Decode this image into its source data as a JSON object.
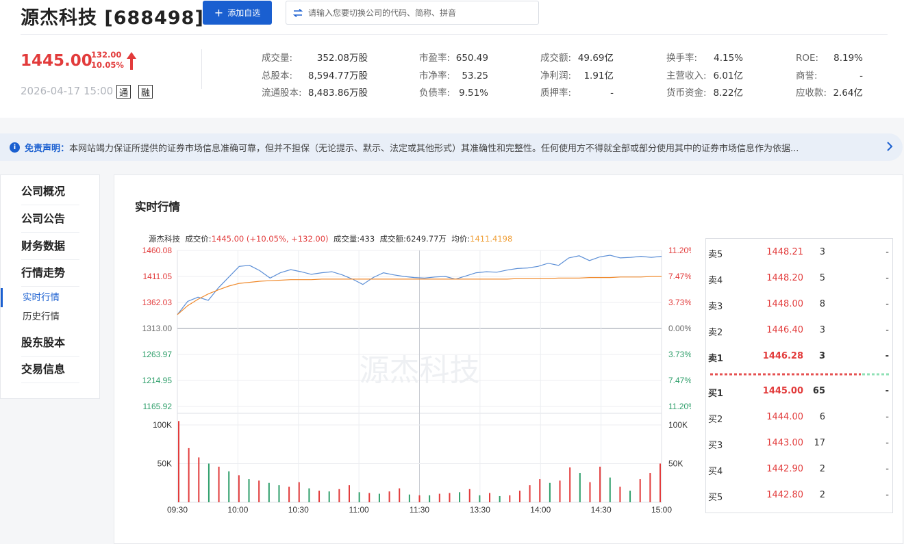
{
  "header": {
    "title": "源杰科技 [688498]",
    "add_button": "添加自选",
    "search_placeholder": "请输入您要切换公司的代码、简称、拼音",
    "price": "1445.00",
    "change": "132.00",
    "change_pct": "10.05%",
    "datetime": "2026-04-17 15:00",
    "tag_tong": "通",
    "tag_rong": "融",
    "stats": [
      {
        "label": "成交量:",
        "value": "352.08万股"
      },
      {
        "label": "总股本:",
        "value": "8,594.77万股"
      },
      {
        "label": "流通股本:",
        "value": "8,483.86万股"
      },
      {
        "label": "市盈率:",
        "value": "650.49"
      },
      {
        "label": "市净率:",
        "value": "53.25"
      },
      {
        "label": "负债率:",
        "value": "9.51%"
      },
      {
        "label": "成交额:",
        "value": "49.69亿"
      },
      {
        "label": "净利润:",
        "value": "1.91亿"
      },
      {
        "label": "质押率:",
        "value": "-"
      },
      {
        "label": "换手率:",
        "value": "4.15%"
      },
      {
        "label": "主营收入:",
        "value": "6.01亿"
      },
      {
        "label": "货币资金:",
        "value": "8.22亿"
      },
      {
        "label": "ROE:",
        "value": "8.19%"
      },
      {
        "label": "商誉:",
        "value": "-"
      },
      {
        "label": "应收款:",
        "value": "2.64亿"
      }
    ]
  },
  "notice": {
    "label": "免责声明：",
    "text": "本网站竭力保证所提供的证券市场信息准确可靠，但并不担保（无论提示、默示、法定或其他形式）其准确性和完整性。任何使用方不得就全部或部分使用其中的证券市场信息作为依据..."
  },
  "sidebar": {
    "items": [
      "公司概况",
      "公司公告",
      "财务数据",
      "行情走势",
      "股东股本",
      "交易信息"
    ],
    "sub_items": [
      "实时行情",
      "历史行情"
    ]
  },
  "main": {
    "title": "实时行情",
    "info": {
      "name": "源杰科技",
      "price_label": "成交价:",
      "price_value": "1445.00 (+10.05%, +132.00)",
      "volume_label": "成交量:",
      "volume_value": "433",
      "amount_label": "成交额:",
      "amount_value": "6249.77万",
      "avg_label": "均价:",
      "avg_value": "1411.4198"
    },
    "watermark": "源杰科技"
  },
  "chart_data": {
    "type": "line",
    "x_ticks": [
      "09:30",
      "10:00",
      "10:30",
      "11:00",
      "11:30",
      "13:30",
      "14:00",
      "14:30",
      "15:00"
    ],
    "y_price_ticks": [
      "1460.08",
      "1411.05",
      "1362.03",
      "1313.00",
      "1263.97",
      "1214.95",
      "1165.92"
    ],
    "y_pct_ticks": [
      "11.20%",
      "7.47%",
      "3.73%",
      "0.00%",
      "3.73%",
      "7.47%",
      "11.20%"
    ],
    "y_vol_ticks": [
      "100K",
      "50K"
    ],
    "ylim": [
      1165.92,
      1460.08
    ],
    "prev_close": 1313.0,
    "series": [
      {
        "values": [
          1339,
          1364,
          1372,
          1366,
          1390,
          1410,
          1430,
          1432,
          1422,
          1408,
          1418,
          1424,
          1420,
          1415,
          1418,
          1420,
          1414,
          1406,
          1396,
          1409,
          1418,
          1414,
          1411,
          1409,
          1408,
          1410,
          1411,
          1406,
          1412,
          1418,
          1420,
          1419,
          1423,
          1426,
          1427,
          1430,
          1436,
          1432,
          1446,
          1450,
          1441,
          1448,
          1451,
          1446,
          1447,
          1449,
          1447,
          1449
        ]
      },
      {
        "values": [
          1339,
          1356,
          1368,
          1378,
          1386,
          1393,
          1398,
          1400,
          1402,
          1403,
          1404,
          1405,
          1405,
          1405,
          1406,
          1406,
          1406,
          1406,
          1406,
          1406,
          1406,
          1406,
          1406,
          1406,
          1406,
          1406,
          1406,
          1406,
          1406,
          1406,
          1406,
          1406,
          1406,
          1407,
          1407,
          1407,
          1407,
          1408,
          1408,
          1408,
          1409,
          1409,
          1409,
          1410,
          1410,
          1410,
          1411,
          1411
        ]
      }
    ],
    "volume": [
      105,
      70,
      58,
      50,
      46,
      40,
      35,
      30,
      28,
      25,
      22,
      20,
      26,
      18,
      15,
      14,
      17,
      22,
      13,
      12,
      11,
      14,
      18,
      10,
      9,
      9,
      11,
      12,
      13,
      17,
      9,
      12,
      8,
      9,
      15,
      22,
      30,
      25,
      28,
      45,
      38,
      26,
      46,
      32,
      20,
      15,
      30,
      38,
      50
    ],
    "volume_colors": [
      "r",
      "r",
      "r",
      "g",
      "r",
      "g",
      "r",
      "g",
      "r",
      "g",
      "g",
      "r",
      "r",
      "g",
      "r",
      "g",
      "r",
      "r",
      "g",
      "r",
      "g",
      "r",
      "r",
      "g",
      "r",
      "g",
      "r",
      "r",
      "g",
      "r",
      "g",
      "r",
      "g",
      "r",
      "r",
      "r",
      "r",
      "g",
      "r",
      "r",
      "g",
      "r",
      "r",
      "g",
      "r",
      "g",
      "r",
      "r",
      "r"
    ]
  },
  "order_book": [
    {
      "label": "卖5",
      "price": "1448.21",
      "volume": "3",
      "delta": "-"
    },
    {
      "label": "卖4",
      "price": "1448.20",
      "volume": "5",
      "delta": "-"
    },
    {
      "label": "卖3",
      "price": "1448.00",
      "volume": "8",
      "delta": "-"
    },
    {
      "label": "卖2",
      "price": "1446.40",
      "volume": "3",
      "delta": "-"
    },
    {
      "label": "卖1",
      "price": "1446.28",
      "volume": "3",
      "delta": "-"
    },
    {
      "label": "买1",
      "price": "1445.00",
      "volume": "65",
      "delta": "-"
    },
    {
      "label": "买2",
      "price": "1444.00",
      "volume": "6",
      "delta": "-"
    },
    {
      "label": "买3",
      "price": "1443.00",
      "volume": "17",
      "delta": "-"
    },
    {
      "label": "买4",
      "price": "1442.90",
      "volume": "2",
      "delta": "-"
    },
    {
      "label": "买5",
      "price": "1442.80",
      "volume": "2",
      "delta": "-"
    }
  ],
  "colors": {
    "accent": "#1a5fd0",
    "up": "#e23b3b",
    "down": "#2e9e6a",
    "price_line": "#5b8ed6",
    "avg_line": "#f08a2c"
  }
}
